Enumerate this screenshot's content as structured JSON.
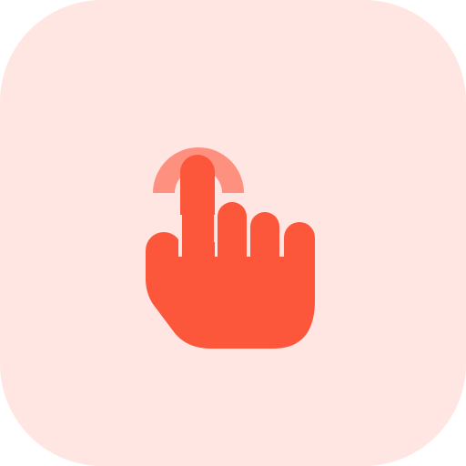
{
  "icon": {
    "name": "tap-gesture-icon",
    "colors": {
      "tile_background": "#FFE6E2",
      "hand": "#FC573B",
      "tap_ring": "#FD907E"
    }
  }
}
